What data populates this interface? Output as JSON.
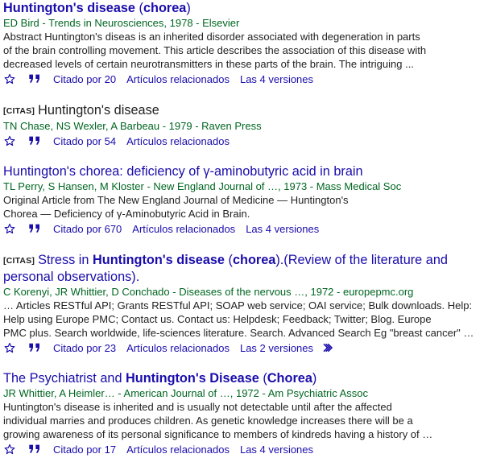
{
  "results": [
    {
      "tag": "",
      "title_parts": [
        {
          "text": "Huntington's disease",
          "bold": true
        },
        {
          "text": " (",
          "bold": false
        },
        {
          "text": "chorea",
          "bold": true
        },
        {
          "text": ")",
          "bold": false
        }
      ],
      "authors": "ED Bird - Trends in Neurosciences, 1978 - Elsevier",
      "snippet": [
        "Abstract Huntington's diseas is an inherited disorder associated with degeneration in parts",
        "of the brain controlling movement. This article describes the association of this disease with",
        "decreased levels of certain neurotransmitters in these parts of the brain. The intriguing ..."
      ],
      "actions": {
        "cited": "Citado por 20",
        "related": "Artículos relacionados",
        "versions": "Las 4 versiones",
        "more": false
      }
    },
    {
      "tag": "[CITAS]",
      "title_parts": [
        {
          "text": "Huntington's disease",
          "bold": false
        }
      ],
      "authors": "TN Chase, NS Wexler, A Barbeau - 1979 - Raven Press",
      "snippet": [],
      "actions": {
        "cited": "Citado por 54",
        "related": "Artículos relacionados",
        "versions": "",
        "more": false
      }
    },
    {
      "tag": "",
      "title_parts": [
        {
          "text": "Huntington's chorea: deficiency of γ-aminobutyric acid in brain",
          "bold": false
        }
      ],
      "authors": "TL Perry, S Hansen, M Kloster - New England Journal of …, 1973 - Mass Medical Soc",
      "snippet": [
        "Original Article from The New England Journal of Medicine — Huntington's",
        "Chorea — Deficiency of γ-Aminobutyric Acid in Brain."
      ],
      "actions": {
        "cited": "Citado por 670",
        "related": "Artículos relacionados",
        "versions": "Las 4 versiones",
        "more": false
      }
    },
    {
      "tag": "[CITAS]",
      "title_parts": [
        {
          "text": "Stress in ",
          "bold": false
        },
        {
          "text": "Huntington's disease",
          "bold": true
        },
        {
          "text": " (",
          "bold": false
        },
        {
          "text": "chorea",
          "bold": true
        },
        {
          "text": ").(Review of the literature and personal observations).",
          "bold": false
        }
      ],
      "authors": "C Korenyi, JR Whittier, D Conchado - Diseases of the nervous …, 1972 - europepmc.org",
      "snippet": [
        "… Articles RESTful API; Grants RESTful API; SOAP web service; OAI service; Bulk downloads. Help:",
        "Help using Europe PMC; Contact us. Contact us: Helpdesk; Feedback; Twitter; Blog. Europe",
        "PMC plus. Search worldwide, life-sciences literature. Search. Advanced Search Eg \"breast cancer\" …"
      ],
      "actions": {
        "cited": "Citado por 23",
        "related": "Artículos relacionados",
        "versions": "Las 2 versiones",
        "more": true
      }
    },
    {
      "tag": "",
      "title_parts": [
        {
          "text": "The Psychiatrist and ",
          "bold": false
        },
        {
          "text": "Huntington's Disease",
          "bold": true
        },
        {
          "text": " (",
          "bold": false
        },
        {
          "text": "Chorea",
          "bold": true
        },
        {
          "text": ")",
          "bold": false
        }
      ],
      "authors": "JR Whittier, A Heimler… - American Journal of …, 1972 - Am Psychiatric Assoc",
      "snippet": [
        "Huntington's disease is inherited and is usually not detectable until after the affected",
        "individual marries and produces children. As genetic knowledge increases there will be a",
        "growing awareness of its personal significance to members of kindreds having a history of …"
      ],
      "actions": {
        "cited": "Citado por 17",
        "related": "Artículos relacionados",
        "versions": "Las 4 versiones",
        "more": false
      }
    }
  ],
  "icons": {
    "save": "star-icon",
    "cite": "quote-icon",
    "more": "double-chevron-icon"
  },
  "colors": {
    "link": "#1a0dab",
    "authors": "#006621",
    "text": "#222222"
  }
}
